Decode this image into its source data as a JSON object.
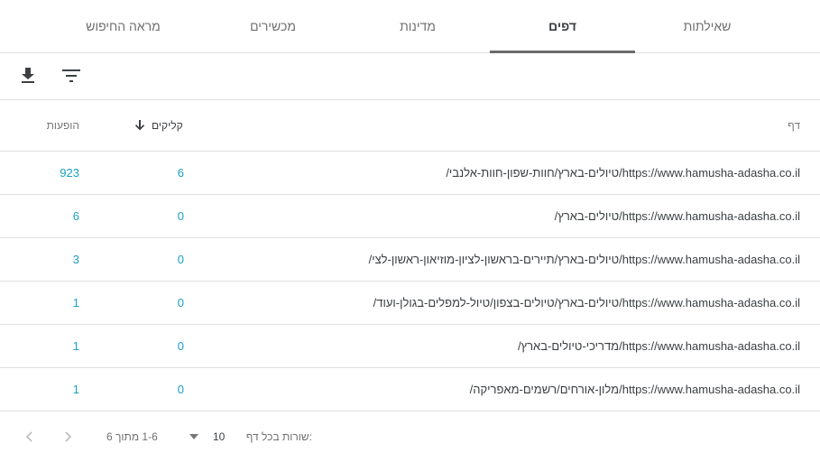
{
  "tabs": [
    {
      "label": "שאילתות",
      "active": false
    },
    {
      "label": "דפים",
      "active": true
    },
    {
      "label": "מדינות",
      "active": false
    },
    {
      "label": "מכשירים",
      "active": false
    },
    {
      "label": "מראה החיפוש",
      "active": false
    }
  ],
  "toolbar": {
    "download_icon": "download-icon",
    "filter_icon": "filter-icon"
  },
  "table": {
    "headers": {
      "page": "דף",
      "clicks": "קליקים",
      "impressions": "הופעות"
    },
    "sort": {
      "column": "clicks",
      "direction": "descending"
    },
    "rows": [
      {
        "page": "https://www.hamusha-adasha.co.il/טיולים-בארץ/חוות-שפון-חוות-אלנבי/",
        "clicks": "6",
        "impressions": "923"
      },
      {
        "page": "https://www.hamusha-adasha.co.il/טיולים-בארץ/",
        "clicks": "0",
        "impressions": "6"
      },
      {
        "page": "https://www.hamusha-adasha.co.il/טיולים-בארץ/תיירים-בראשון-לציון-מוזיאון-ראשון-לצי/",
        "clicks": "0",
        "impressions": "3"
      },
      {
        "page": "https://www.hamusha-adasha.co.il/טיולים-בארץ/טיולים-בצפון/טיול-למפלים-בגולן-ועוד/",
        "clicks": "0",
        "impressions": "1"
      },
      {
        "page": "https://www.hamusha-adasha.co.il/מדריכי-טיולים-בארץ/",
        "clicks": "0",
        "impressions": "1"
      },
      {
        "page": "https://www.hamusha-adasha.co.il/מלון-אורחים/רשמים-מאפריקה/",
        "clicks": "0",
        "impressions": "1"
      }
    ]
  },
  "pagination": {
    "rows_label": "שורות בכל דף:",
    "rows_value": "10",
    "range": "1-6 מתוך 6"
  },
  "colors": {
    "accent": "#1aa0c4",
    "tab_underline": "#6b6b6b",
    "divider": "#e0e0e0"
  }
}
